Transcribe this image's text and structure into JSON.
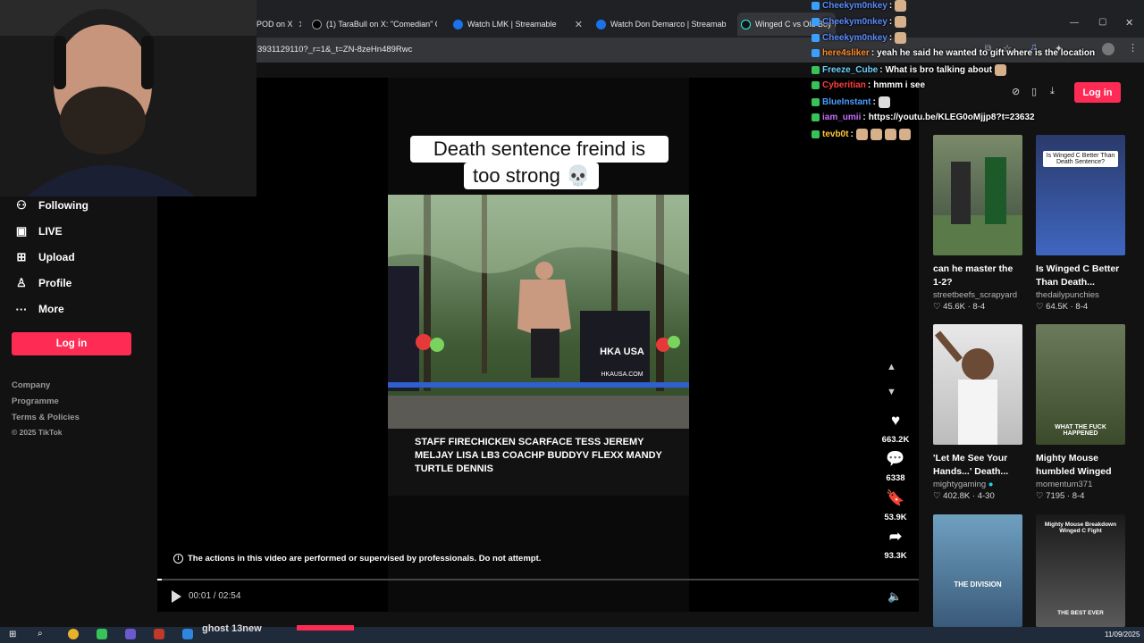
{
  "browser": {
    "tabs": [
      {
        "title": "POD on X",
        "color": "#000000"
      },
      {
        "title": "(1) TaraBull on X: \"Comedian\" C",
        "color": "#000000"
      },
      {
        "title": "Watch LMK | Streamable",
        "color": "#1a73e8"
      },
      {
        "title": "Watch Don Demarco | Streamab",
        "color": "#1a73e8"
      },
      {
        "title": "Winged C vs Old Boy W",
        "color": "#111111"
      }
    ],
    "url": "3931129110?_r=1&_t=ZN-8zeHn489Rwc"
  },
  "sidebar": {
    "items": [
      {
        "label": "Following",
        "icon": "following-icon"
      },
      {
        "label": "LIVE",
        "icon": "live-icon"
      },
      {
        "label": "Upload",
        "icon": "upload-icon"
      },
      {
        "label": "Profile",
        "icon": "profile-icon"
      },
      {
        "label": "More",
        "icon": "more-icon"
      }
    ],
    "login_label": "Log in",
    "footer": [
      "Company",
      "Programme",
      "Terms & Policies",
      "© 2025 TikTok"
    ]
  },
  "video": {
    "caption_line1": "Death sentence freind is",
    "caption_line2": "too strong 💀",
    "disclaimer": "The actions in this video are performed or supervised by professionals. Do not attempt.",
    "time": "00:01 / 02:54",
    "progress_fraction": 0.006,
    "banner_text": "HKA USA",
    "banner_url": "HKAUSA.COM",
    "sign_names": "STAFF  FIRECHICKEN  SCARFACE  TESS  JEREMY  MELJAY  LISA  LB3  COACHP  BUDDYV  FLEXX  MANDY  TURTLE  DENNIS"
  },
  "actions": {
    "likes": "663.2K",
    "comments": "6338",
    "saves": "53.9K",
    "shares": "93.3K"
  },
  "header": {
    "login_label": "Log in"
  },
  "related": [
    {
      "title": "can he master the 1-2?",
      "author": "streetbeefs_scrapyard",
      "stats": "♡ 45.6K · 8-4",
      "thumb_color": "#3a4a3a"
    },
    {
      "title": "Is Winged C Better Than Death...",
      "author": "thedailypunchies",
      "stats": "♡ 64.5K · 8-4",
      "thumb_color": "#2f4a8a",
      "thumb_text": "Is Winged C Better Than Death Sentence?"
    },
    {
      "title": "'Let Me See Your Hands...' Death...",
      "author": "mightygaming",
      "stats": "♡ 402.8K · 4-30",
      "thumb_color": "#cfcfcf"
    },
    {
      "title": "Mighty Mouse humbled Winged C...",
      "author": "momentum371",
      "stats": "♡ 7195 · 8-4",
      "thumb_color": "#4a5a3a",
      "thumb_text": "WHAT THE FUCK HAPPENED"
    },
    {
      "title": "",
      "author": "",
      "stats": "",
      "thumb_color": "#4a6a8a",
      "thumb_text": "THE DIVISION"
    },
    {
      "title": "",
      "author": "",
      "stats": "",
      "thumb_color": "#6a6a6a",
      "thumb_text": "Mighty Mouse Breakdown Winged C Fight"
    }
  ],
  "related_extra_text": "THE BEST EVER",
  "chat": [
    {
      "user": "Cheekym0nkey",
      "msg": "",
      "color": "#5a8cff",
      "badge": "#3aa0ff",
      "emotes": 1
    },
    {
      "user": "Cheekym0nkey",
      "msg": "",
      "color": "#5a8cff",
      "badge": "#3aa0ff",
      "emotes": 1
    },
    {
      "user": "Cheekym0nkey",
      "msg": "",
      "color": "#5a8cff",
      "badge": "#3aa0ff",
      "emotes": 1
    },
    {
      "user": "here4sliker",
      "msg": "yeah he said he wanted to gift where is the location",
      "color": "#ff8c2a",
      "badge": "#3aa0ff",
      "emotes": 0
    },
    {
      "user": "Freeze_Cube",
      "msg": "What is bro talking about",
      "color": "#6fd0ff",
      "badge": "#37c25a",
      "emotes": 1
    },
    {
      "user": "Cyberitian",
      "msg": "hmmm i see",
      "color": "#ff3c3c",
      "badge": "#37c25a",
      "emotes": 0
    },
    {
      "user": "BlueInstant",
      "msg": "",
      "color": "#4a9cff",
      "badge": "#37c25a",
      "emotes": 1
    },
    {
      "user": "iam_umii",
      "msg": "https://youtu.be/KLEG0oMjjp8?t=23632",
      "color": "#c86cff",
      "badge": "#37c25a",
      "emotes": 0
    },
    {
      "user": "tevb0t",
      "msg": "",
      "color": "#ffc83a",
      "badge": "#37c25a",
      "emotes": 4
    }
  ],
  "taskbar": {
    "date": "11/09/2025"
  },
  "overlay_name": "ghost 13new"
}
